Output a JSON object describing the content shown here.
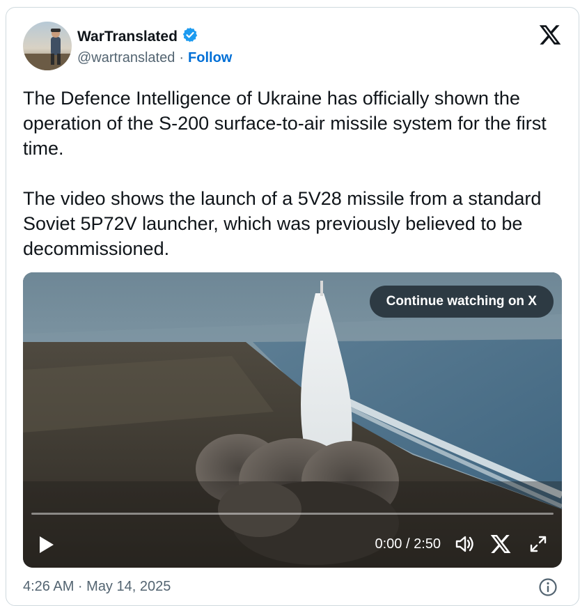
{
  "author": {
    "display_name": "WarTranslated",
    "handle": "@wartranslated",
    "separator": "·",
    "follow_label": "Follow",
    "verified_color": "#1d9bf0"
  },
  "tweet": {
    "paragraphs": [
      "The Defence Intelligence of Ukraine has officially shown the operation of the S-200 surface-to-air missile system for the first time.",
      "The video shows the launch of a 5V28 missile from a standard Soviet 5P72V launcher, which was previously believed to be decommissioned."
    ],
    "timestamp": "4:26 AM · May 14, 2025"
  },
  "video": {
    "continue_label": "Continue watching on X",
    "time_display": "0:00 / 2:50",
    "progress": 0
  },
  "icons": {
    "platform_logo": "x-logo-icon",
    "verified": "verified-badge-icon",
    "play": "play-icon",
    "volume": "volume-icon",
    "x_small": "x-logo-small-icon",
    "fullscreen": "fullscreen-icon",
    "info": "info-icon"
  },
  "colors": {
    "link": "#006fd6",
    "muted": "#536471",
    "text": "#0f1419",
    "border": "#cfd9de"
  }
}
